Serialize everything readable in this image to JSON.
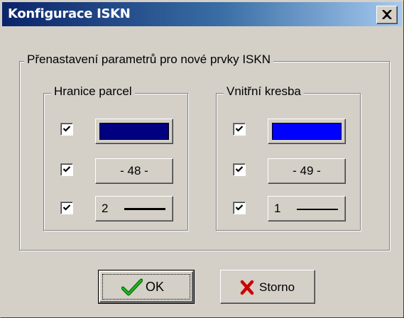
{
  "window": {
    "title": "Konfigurace ISKN",
    "close_icon": "close-icon"
  },
  "main_group": {
    "legend": "Přenastavení parametrů pro nové prvky ISKN"
  },
  "left_group": {
    "legend": "Hranice parcel",
    "rows": [
      {
        "checked": true,
        "kind": "color",
        "color": "#000080"
      },
      {
        "checked": true,
        "kind": "level",
        "label": "- 48 -"
      },
      {
        "checked": true,
        "kind": "line",
        "label": "2"
      }
    ]
  },
  "right_group": {
    "legend": "Vnitřní kresba",
    "rows": [
      {
        "checked": true,
        "kind": "color",
        "color": "#0000ff"
      },
      {
        "checked": true,
        "kind": "level",
        "label": "- 49 -"
      },
      {
        "checked": true,
        "kind": "line",
        "label": "1"
      }
    ]
  },
  "buttons": {
    "ok": {
      "label": "OK",
      "icon": "checkmark-icon",
      "icon_color": "#008000"
    },
    "cancel": {
      "label": "Storno",
      "icon": "x-icon",
      "icon_color": "#cc0000"
    }
  }
}
